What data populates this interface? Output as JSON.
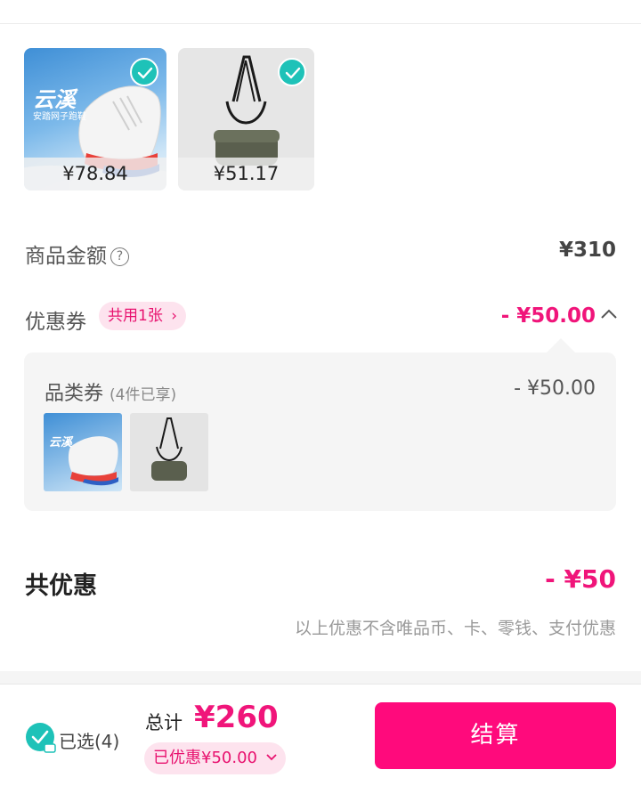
{
  "products": [
    {
      "price": "¥78.84",
      "kind": "shoe",
      "brand_text": "云溪",
      "sub_text": "安踏网子跑鞋"
    },
    {
      "price": "¥51.17",
      "kind": "bag"
    }
  ],
  "summary": {
    "goods_amount_label": "商品金额",
    "goods_amount_value": "¥310",
    "coupon_label": "优惠券",
    "coupon_pill": "共用1张",
    "coupon_value": "- ¥50.00"
  },
  "coupon_detail": {
    "title": "品类券",
    "note": "(4件已享)",
    "value": "- ¥50.00"
  },
  "total_discount": {
    "label": "共优惠",
    "value": "- ¥50",
    "footnote": "以上优惠不含唯品币、卡、零钱、支付优惠"
  },
  "bottom": {
    "selected_label": "已选(4)",
    "total_prefix": "总计",
    "total_value": "¥260",
    "saved_label": "已优惠¥50.00",
    "checkout_label": "结算"
  },
  "colors": {
    "accent": "#ff0a7c",
    "check": "#1ec2b8",
    "pill_bg": "#fde3ee"
  }
}
